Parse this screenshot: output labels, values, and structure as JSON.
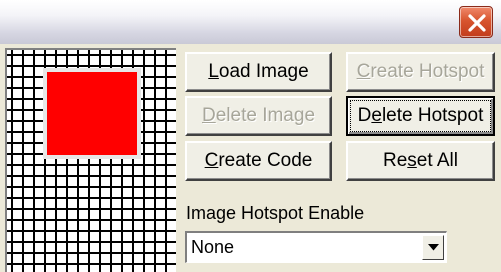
{
  "window": {
    "close_icon": "close-x-icon",
    "close_color": "#d8552f"
  },
  "buttons": {
    "load_image": {
      "label": "Load Image",
      "underline": "L",
      "enabled": true
    },
    "create_hotspot": {
      "label": "Create Hotspot",
      "underline": "C",
      "enabled": false
    },
    "delete_image": {
      "label": "Delete Image",
      "underline": "D",
      "enabled": false
    },
    "delete_hotspot": {
      "label": "Delete Hotspot",
      "underline": "e",
      "enabled": true,
      "focused": true
    },
    "create_code": {
      "label": "Create Code",
      "underline": "C",
      "enabled": true
    },
    "reset_all": {
      "label": "Reset All",
      "underline": "s",
      "enabled": true
    }
  },
  "hotspot_enable": {
    "label": "Image Hotspot Enable",
    "selected": "None",
    "arrow_icon": "dropdown-arrow-icon"
  },
  "canvas": {
    "grid": true,
    "image_color": "#ff0000"
  }
}
